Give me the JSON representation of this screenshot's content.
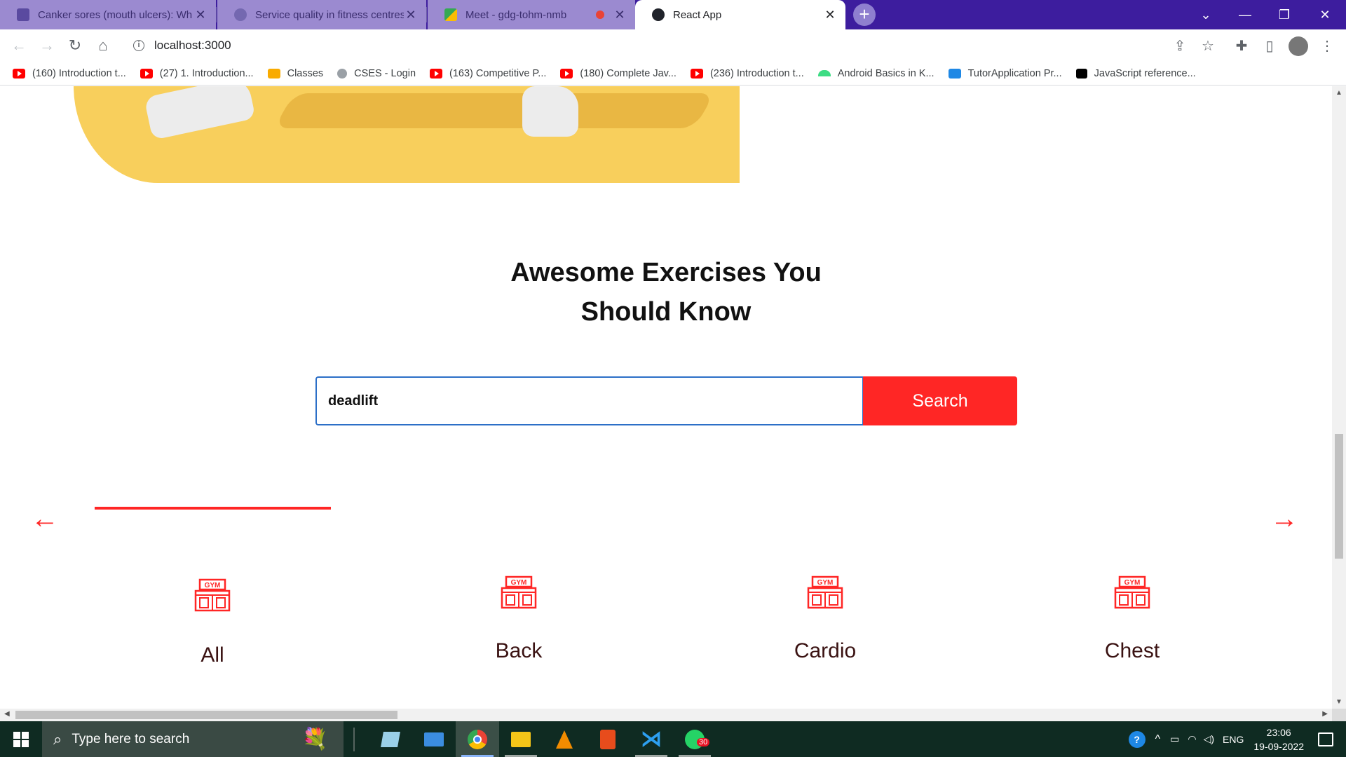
{
  "browser": {
    "tabs": [
      {
        "title": "Canker sores (mouth ulcers): Wh",
        "active": false
      },
      {
        "title": "Service quality in fitness centres:",
        "active": false
      },
      {
        "title": "Meet - gdg-tohm-nmb",
        "active": false
      },
      {
        "title": "React App",
        "active": true
      }
    ],
    "url": "localhost:3000",
    "bookmarks": [
      {
        "label": "(160) Introduction t...",
        "icon": "youtube"
      },
      {
        "label": "(27) 1. Introduction...",
        "icon": "youtube"
      },
      {
        "label": "Classes",
        "icon": "classroom"
      },
      {
        "label": "CSES - Login",
        "icon": "globe"
      },
      {
        "label": "(163) Competitive P...",
        "icon": "youtube"
      },
      {
        "label": "(180) Complete Jav...",
        "icon": "youtube"
      },
      {
        "label": "(236) Introduction t...",
        "icon": "youtube"
      },
      {
        "label": "Android Basics in K...",
        "icon": "android"
      },
      {
        "label": "TutorApplication Pr...",
        "icon": "tutor"
      },
      {
        "label": "JavaScript reference...",
        "icon": "mdn"
      }
    ]
  },
  "page": {
    "heading_line1": "Awesome Exercises You",
    "heading_line2": "Should Know",
    "search": {
      "value": "deadlift",
      "button_label": "Search"
    },
    "categories": [
      {
        "label": "All",
        "icon": "gym-icon"
      },
      {
        "label": "Back",
        "icon": "gym-icon"
      },
      {
        "label": "Cardio",
        "icon": "gym-icon"
      },
      {
        "label": "Chest",
        "icon": "gym-icon"
      }
    ],
    "accent_color": "#ff2625"
  },
  "taskbar": {
    "search_placeholder": "Type here to search",
    "whatsapp_badge": "30",
    "language": "ENG",
    "time": "23:06",
    "date": "19-09-2022"
  }
}
